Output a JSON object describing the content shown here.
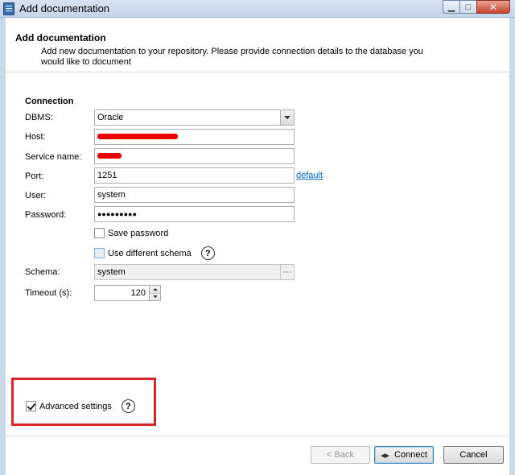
{
  "window": {
    "title": "Add documentation"
  },
  "header": {
    "title": "Add documentation",
    "description": "Add new documentation to your repository. Please provide connection details to the database you would like to document"
  },
  "connection": {
    "section_title": "Connection",
    "dbms": {
      "label": "DBMS:",
      "value": "Oracle"
    },
    "host": {
      "label": "Host:"
    },
    "service_name": {
      "label": "Service name:"
    },
    "port": {
      "label": "Port:",
      "value": "1251",
      "default_link": "default"
    },
    "user": {
      "label": "User:",
      "value": "system"
    },
    "password": {
      "label": "Password:",
      "value": "●●●●●●●●●"
    },
    "save_password": {
      "label": "Save password",
      "checked": false
    },
    "use_different_schema": {
      "label": "Use different schema",
      "checked": false,
      "help": "?"
    },
    "schema": {
      "label": "Schema:",
      "value": "system",
      "browse": "···"
    },
    "timeout": {
      "label": "Timeout (s):",
      "value": "120"
    }
  },
  "advanced": {
    "label": "Advanced settings",
    "checked": true,
    "help": "?"
  },
  "buttons": {
    "back": "< Back",
    "connect": "Connect",
    "cancel": "Cancel"
  },
  "colors": {
    "highlight": "#d9262c",
    "link": "#0066cc",
    "redaction": "#ee0000"
  }
}
